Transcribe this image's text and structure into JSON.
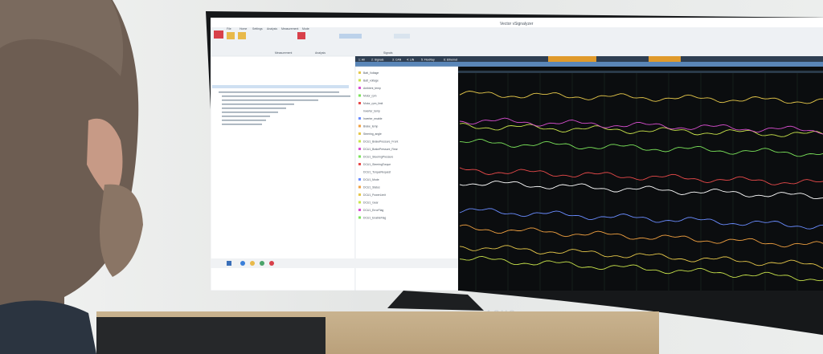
{
  "window": {
    "title": "Vector vSignalyzer"
  },
  "ribbon": {
    "tabs": [
      "File",
      "Home",
      "Settings",
      "Analysis",
      "Measurement",
      "Mode"
    ],
    "groups": [
      "Measurement",
      "Analysis",
      "Signals"
    ]
  },
  "channel_tabs": [
    "1: All",
    "2: Signals",
    "3: CAN",
    "4: LIN",
    "5: FlexRay",
    "6: Ethernet"
  ],
  "signals": [
    "Batt_Voltage",
    "Batt_voltage",
    "Ambient_temp",
    "Motor_rpm",
    "Motor_rpm_limit",
    "Inverter_temp",
    "Inverter_enable",
    "Brake_temp",
    "Steering_angle",
    "DCU1_BrakePressure_Front",
    "DCU1_BrakePressure_Rear",
    "DCU1_SteeringPressure",
    "DCU1_SteeringTorque",
    "DCU1_TorqueRequest",
    "DCU1_Mode",
    "DCU1_Status",
    "DCU1_PowerLimit",
    "DCU1_Gear",
    "DCU1_ErrorFlag",
    "DCU1_EnableFlag"
  ],
  "brand": {
    "logo_text": "ASUS"
  },
  "colors": {
    "plot_bg": "#0b0d0f",
    "traces": [
      "#e6c84a",
      "#c9e44b",
      "#d94fd0",
      "#7be35a",
      "#e84a4a",
      "#ffffff",
      "#6a8cff",
      "#f0a040"
    ]
  }
}
